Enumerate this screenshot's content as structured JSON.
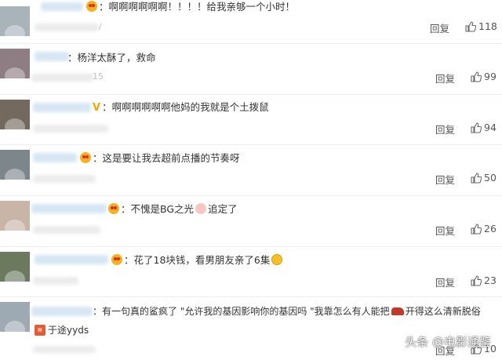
{
  "comments": [
    {
      "text": "啊啊啊啊啊啊！！！！给我亲够一个小时！",
      "emoji": "love",
      "reply": "回复",
      "likes": "118",
      "fragment": "/",
      "avatar_color": "#a9b3ba"
    },
    {
      "text": "杨洋太酥了，救命",
      "emoji": "",
      "reply": "回复",
      "likes": "99",
      "fragment": "15",
      "avatar_color": "#8f7d84"
    },
    {
      "text": "啊啊啊啊啊啊他妈的我就是个土拨鼠",
      "emoji": "",
      "badge": "V",
      "reply": "回复",
      "likes": "94",
      "fragment": "",
      "avatar_color": "#74695f"
    },
    {
      "text": "这是要让我去超前点播的节奏呀",
      "emoji": "love",
      "reply": "回复",
      "likes": "50",
      "fragment": "",
      "avatar_color": "#7d868a"
    },
    {
      "text_before": "不愧是BG之光",
      "text_after": "追定了",
      "emoji": "love",
      "inline_emoji": "blush",
      "reply": "回复",
      "likes": "26",
      "fragment": "",
      "avatar_color": "#c9b4a8"
    },
    {
      "text": "花了18块钱，看男朋友亲了6集",
      "emoji": "love",
      "trailing_emoji": "lol",
      "reply": "回复",
      "likes": "23",
      "fragment": "",
      "avatar_color": "#6b7a5e"
    },
    {
      "text_line1_a": "有一句真的鲨疯了 \"允许我的基因影响你的基因吗 \"我靠怎么有人能把",
      "text_line1_b": "开得这么清新脱俗",
      "text_line2": "于途yyds",
      "emoji": "",
      "reply": "回复",
      "likes": "10",
      "fragment": "",
      "avatar_color": "#9fa9b4"
    }
  ],
  "watermark": "头条 @电影通鉴",
  "colors": {
    "text": "#333333",
    "like_icon": "#666666",
    "emoji": "#f5b21f"
  }
}
